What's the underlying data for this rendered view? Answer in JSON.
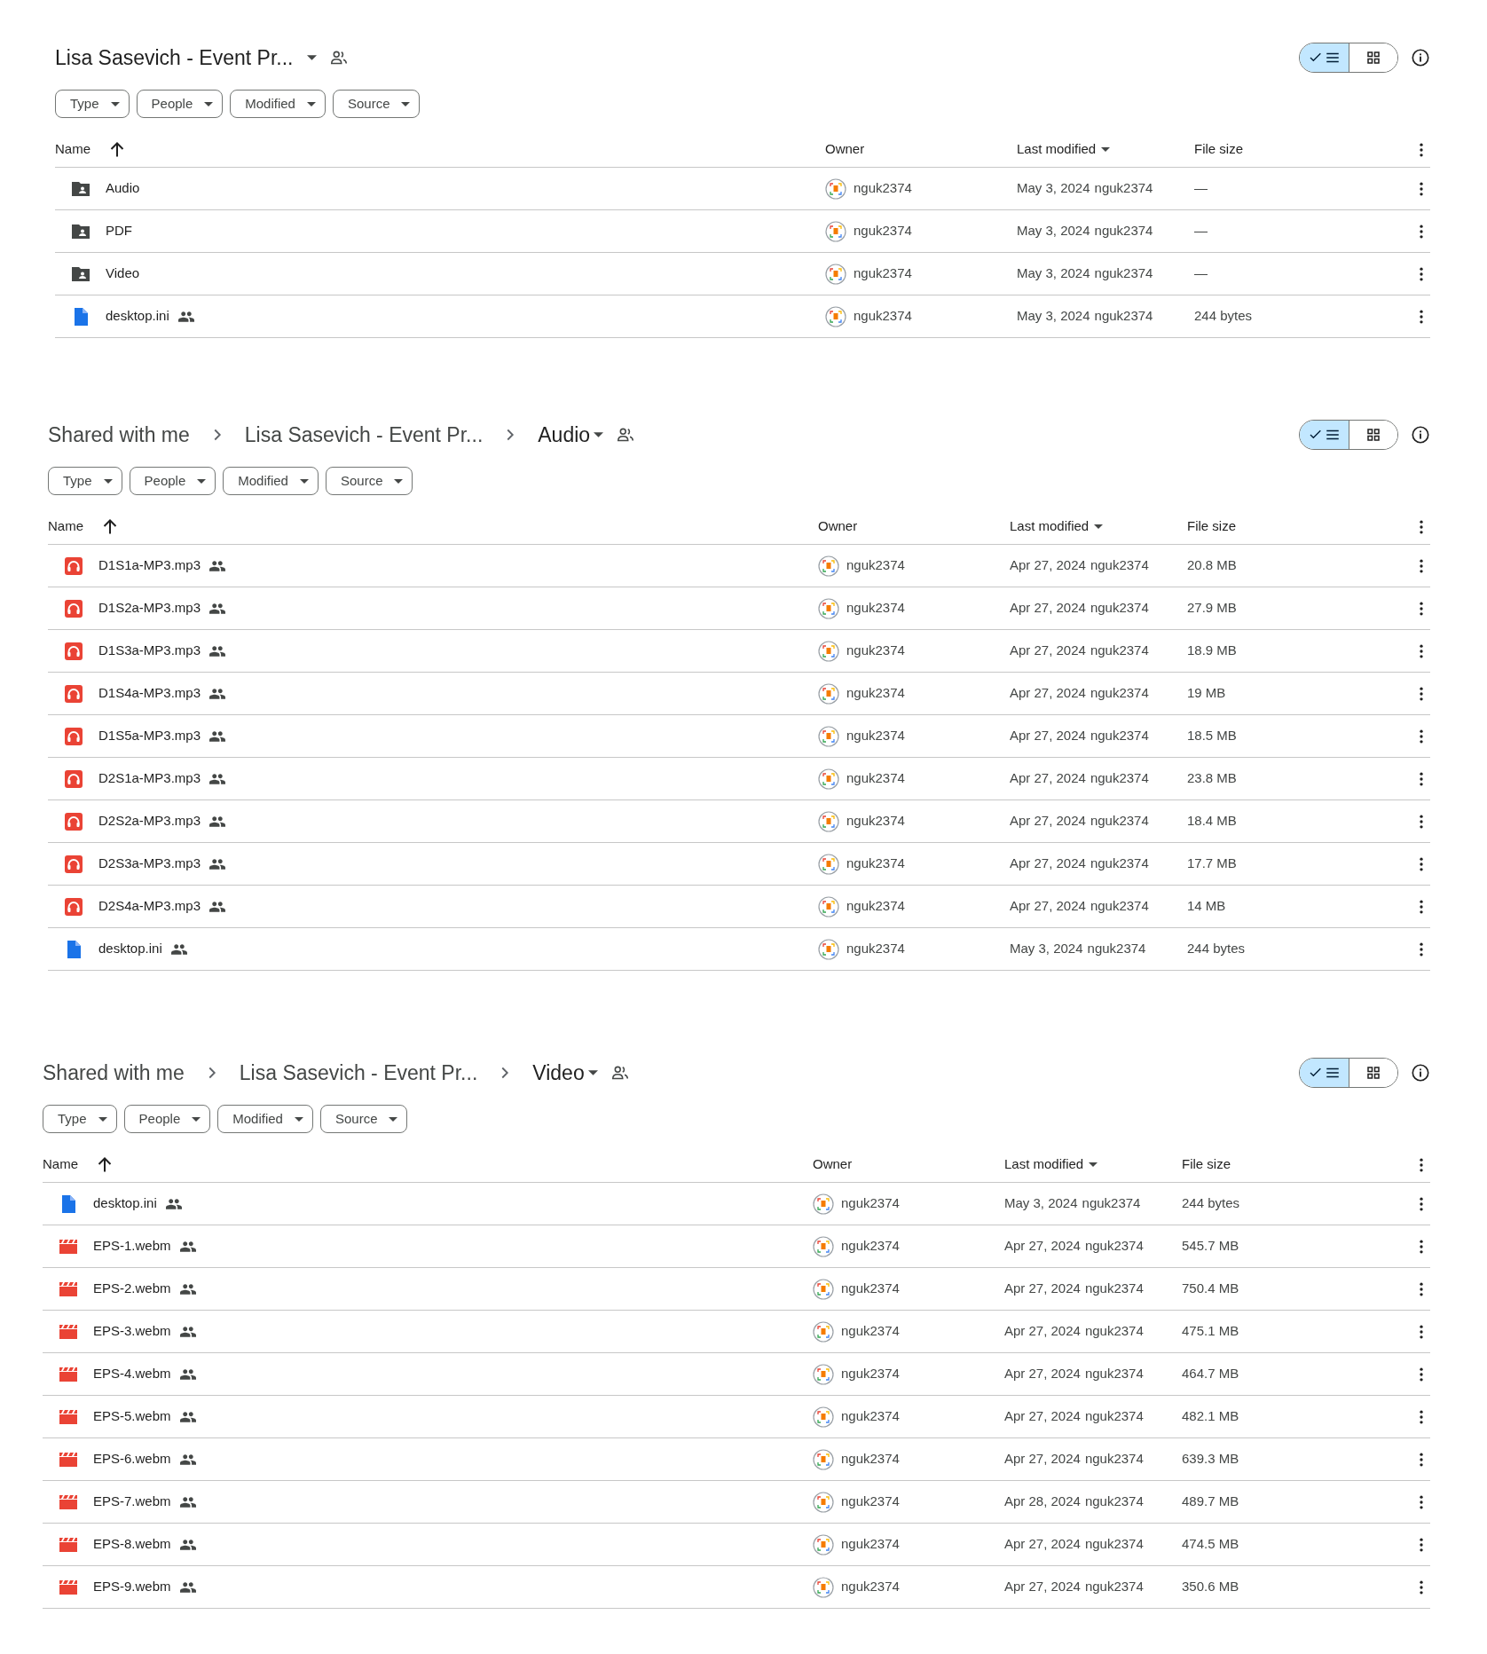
{
  "panels": [
    {
      "breadcrumb": [
        {
          "text": "Lisa Sasevich - Event Pr...",
          "current": true
        }
      ],
      "view_toggle": [
        {
          "kind": "list",
          "selected": true
        },
        {
          "kind": "grid",
          "selected": false
        }
      ],
      "filters": [
        "Type",
        "People",
        "Modified",
        "Source"
      ],
      "columns": [
        {
          "label": "Name",
          "kind": "arrow"
        },
        {
          "label": "Owner",
          "kind": "plain"
        },
        {
          "label": "Last modified",
          "kind": "caret"
        },
        {
          "label": "File size",
          "kind": "plain"
        }
      ],
      "rows": [
        {
          "kind": "folder",
          "name": "Audio",
          "shared": false,
          "owner": "nguk2374",
          "modified": "May 3, 2024",
          "modified_by": "nguk2374",
          "size": "—"
        },
        {
          "kind": "folder",
          "name": "PDF",
          "shared": false,
          "owner": "nguk2374",
          "modified": "May 3, 2024",
          "modified_by": "nguk2374",
          "size": "—"
        },
        {
          "kind": "folder",
          "name": "Video",
          "shared": false,
          "owner": "nguk2374",
          "modified": "May 3, 2024",
          "modified_by": "nguk2374",
          "size": "—"
        },
        {
          "kind": "file",
          "name": "desktop.ini",
          "shared": true,
          "owner": "nguk2374",
          "modified": "May 3, 2024",
          "modified_by": "nguk2374",
          "size": "244 bytes"
        }
      ]
    },
    {
      "breadcrumb": [
        {
          "text": "Shared with me",
          "current": false
        },
        {
          "text": "Lisa Sasevich - Event Pr...",
          "current": false
        },
        {
          "text": "Audio",
          "current": true
        }
      ],
      "view_toggle": [
        {
          "kind": "list",
          "selected": true
        },
        {
          "kind": "grid",
          "selected": false
        }
      ],
      "filters": [
        "Type",
        "People",
        "Modified",
        "Source"
      ],
      "columns": [
        {
          "label": "Name",
          "kind": "arrow"
        },
        {
          "label": "Owner",
          "kind": "plain"
        },
        {
          "label": "Last modified",
          "kind": "caret"
        },
        {
          "label": "File size",
          "kind": "plain"
        }
      ],
      "rows": [
        {
          "kind": "audio",
          "name": "D1S1a-MP3.mp3",
          "shared": true,
          "owner": "nguk2374",
          "modified": "Apr 27, 2024",
          "modified_by": "nguk2374",
          "size": "20.8 MB"
        },
        {
          "kind": "audio",
          "name": "D1S2a-MP3.mp3",
          "shared": true,
          "owner": "nguk2374",
          "modified": "Apr 27, 2024",
          "modified_by": "nguk2374",
          "size": "27.9 MB"
        },
        {
          "kind": "audio",
          "name": "D1S3a-MP3.mp3",
          "shared": true,
          "owner": "nguk2374",
          "modified": "Apr 27, 2024",
          "modified_by": "nguk2374",
          "size": "18.9 MB"
        },
        {
          "kind": "audio",
          "name": "D1S4a-MP3.mp3",
          "shared": true,
          "owner": "nguk2374",
          "modified": "Apr 27, 2024",
          "modified_by": "nguk2374",
          "size": "19 MB"
        },
        {
          "kind": "audio",
          "name": "D1S5a-MP3.mp3",
          "shared": true,
          "owner": "nguk2374",
          "modified": "Apr 27, 2024",
          "modified_by": "nguk2374",
          "size": "18.5 MB"
        },
        {
          "kind": "audio",
          "name": "D2S1a-MP3.mp3",
          "shared": true,
          "owner": "nguk2374",
          "modified": "Apr 27, 2024",
          "modified_by": "nguk2374",
          "size": "23.8 MB"
        },
        {
          "kind": "audio",
          "name": "D2S2a-MP3.mp3",
          "shared": true,
          "owner": "nguk2374",
          "modified": "Apr 27, 2024",
          "modified_by": "nguk2374",
          "size": "18.4 MB"
        },
        {
          "kind": "audio",
          "name": "D2S3a-MP3.mp3",
          "shared": true,
          "owner": "nguk2374",
          "modified": "Apr 27, 2024",
          "modified_by": "nguk2374",
          "size": "17.7 MB"
        },
        {
          "kind": "audio",
          "name": "D2S4a-MP3.mp3",
          "shared": true,
          "owner": "nguk2374",
          "modified": "Apr 27, 2024",
          "modified_by": "nguk2374",
          "size": "14 MB"
        },
        {
          "kind": "file",
          "name": "desktop.ini",
          "shared": true,
          "owner": "nguk2374",
          "modified": "May 3, 2024",
          "modified_by": "nguk2374",
          "size": "244 bytes"
        }
      ]
    },
    {
      "breadcrumb": [
        {
          "text": "Shared with me",
          "current": false
        },
        {
          "text": "Lisa Sasevich - Event Pr...",
          "current": false
        },
        {
          "text": "Video",
          "current": true
        }
      ],
      "view_toggle": [
        {
          "kind": "list",
          "selected": true
        },
        {
          "kind": "grid",
          "selected": false
        }
      ],
      "filters": [
        "Type",
        "People",
        "Modified",
        "Source"
      ],
      "columns": [
        {
          "label": "Name",
          "kind": "arrow"
        },
        {
          "label": "Owner",
          "kind": "plain"
        },
        {
          "label": "Last modified",
          "kind": "caret"
        },
        {
          "label": "File size",
          "kind": "plain"
        }
      ],
      "rows": [
        {
          "kind": "file",
          "name": "desktop.ini",
          "shared": true,
          "owner": "nguk2374",
          "modified": "May 3, 2024",
          "modified_by": "nguk2374",
          "size": "244 bytes"
        },
        {
          "kind": "video",
          "name": "EPS-1.webm",
          "shared": true,
          "owner": "nguk2374",
          "modified": "Apr 27, 2024",
          "modified_by": "nguk2374",
          "size": "545.7 MB"
        },
        {
          "kind": "video",
          "name": "EPS-2.webm",
          "shared": true,
          "owner": "nguk2374",
          "modified": "Apr 27, 2024",
          "modified_by": "nguk2374",
          "size": "750.4 MB"
        },
        {
          "kind": "video",
          "name": "EPS-3.webm",
          "shared": true,
          "owner": "nguk2374",
          "modified": "Apr 27, 2024",
          "modified_by": "nguk2374",
          "size": "475.1 MB"
        },
        {
          "kind": "video",
          "name": "EPS-4.webm",
          "shared": true,
          "owner": "nguk2374",
          "modified": "Apr 27, 2024",
          "modified_by": "nguk2374",
          "size": "464.7 MB"
        },
        {
          "kind": "video",
          "name": "EPS-5.webm",
          "shared": true,
          "owner": "nguk2374",
          "modified": "Apr 27, 2024",
          "modified_by": "nguk2374",
          "size": "482.1 MB"
        },
        {
          "kind": "video",
          "name": "EPS-6.webm",
          "shared": true,
          "owner": "nguk2374",
          "modified": "Apr 27, 2024",
          "modified_by": "nguk2374",
          "size": "639.3 MB"
        },
        {
          "kind": "video",
          "name": "EPS-7.webm",
          "shared": true,
          "owner": "nguk2374",
          "modified": "Apr 28, 2024",
          "modified_by": "nguk2374",
          "size": "489.7 MB"
        },
        {
          "kind": "video",
          "name": "EPS-8.webm",
          "shared": true,
          "owner": "nguk2374",
          "modified": "Apr 27, 2024",
          "modified_by": "nguk2374",
          "size": "474.5 MB"
        },
        {
          "kind": "video",
          "name": "EPS-9.webm",
          "shared": true,
          "owner": "nguk2374",
          "modified": "Apr 27, 2024",
          "modified_by": "nguk2374",
          "size": "350.6 MB"
        }
      ]
    }
  ]
}
